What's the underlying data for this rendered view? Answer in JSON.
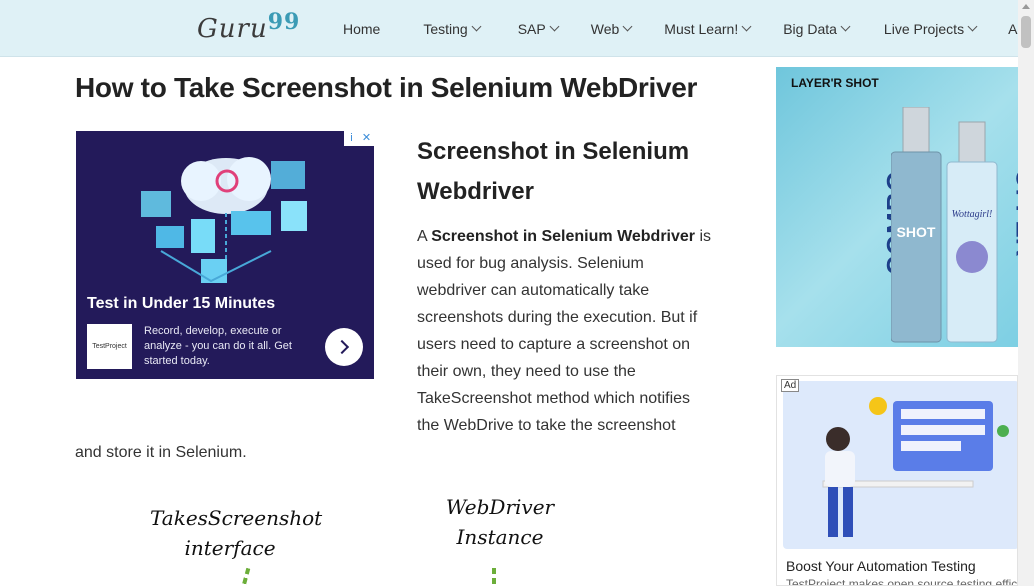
{
  "header": {
    "logo": {
      "text": "Guru",
      "num": "99"
    },
    "nav": [
      {
        "label": "Home",
        "has_dropdown": false
      },
      {
        "label": "Testing",
        "has_dropdown": true
      },
      {
        "label": "SAP",
        "has_dropdown": true
      },
      {
        "label": "Web",
        "has_dropdown": true
      },
      {
        "label": "Must Learn!",
        "has_dropdown": true
      },
      {
        "label": "Big Data",
        "has_dropdown": true
      },
      {
        "label": "Live Projects",
        "has_dropdown": true
      },
      {
        "label": "AI",
        "has_dropdown": true
      }
    ]
  },
  "article": {
    "title": "How to Take Screenshot in Selenium WebDriver",
    "subtitle": "Screenshot in Selenium Webdriver",
    "para_intro": "A ",
    "para_bold": "Screenshot in Selenium Webdriver",
    "para_rest": " is used for bug analysis. Selenium webdriver can automatically take screenshots during the execution. But if users need to capture a screenshot on their own, they need to use the TakeScreenshot method which notifies the WebDrive to take the screenshot",
    "para_tail": "and store it in Selenium.",
    "diagram": {
      "label_1": "TakesScreenshot interface",
      "label_2": "WebDriver Instance"
    }
  },
  "ad_left": {
    "badge_info": "i",
    "badge_close": "✕",
    "headline": "Test in Under 15 Minutes",
    "logo_text": "TestProject",
    "description": "Record, develop, execute or analyze - you can do it all. Get started today."
  },
  "ad_right_top": {
    "brand": "LAYER'R SHOT",
    "left_vertical": "COMBO",
    "right_vertical": "OFFER",
    "bottle1": "SHOT",
    "bottle2": "Wottagirl!"
  },
  "ad_right_bottom": {
    "label": "Ad",
    "headline": "Boost Your Automation Testing",
    "subline": "TestProject makes open source testing effic"
  },
  "colors": {
    "header_bg": "#dff1f6",
    "logo_accent": "#3b9bb5",
    "ad_left_bg": "#231a5a"
  }
}
